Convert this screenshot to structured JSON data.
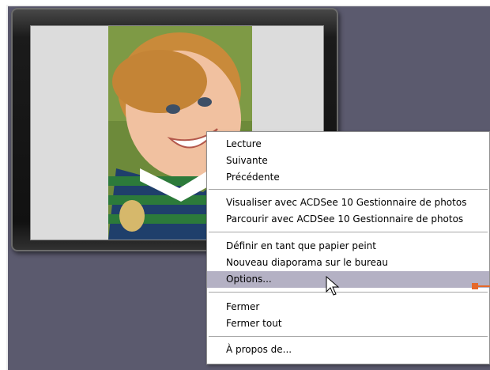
{
  "menu": {
    "items": [
      {
        "label": "Lecture"
      },
      {
        "label": "Suivante"
      },
      {
        "label": "Précédente"
      },
      {
        "label": "Visualiser avec ACDSee 10 Gestionnaire de photos"
      },
      {
        "label": "Parcourir avec ACDSee 10 Gestionnaire de photos"
      },
      {
        "label": "Définir en tant que papier peint"
      },
      {
        "label": "Nouveau diaporama sur le bureau"
      },
      {
        "label": "Options..."
      },
      {
        "label": "Fermer"
      },
      {
        "label": "Fermer tout"
      },
      {
        "label": "À propos de..."
      }
    ],
    "selected_item": "Options..."
  },
  "colors": {
    "desktop": "#5b5a6e",
    "menu_highlight": "#b4b1c4",
    "callout": "#e5692a"
  }
}
